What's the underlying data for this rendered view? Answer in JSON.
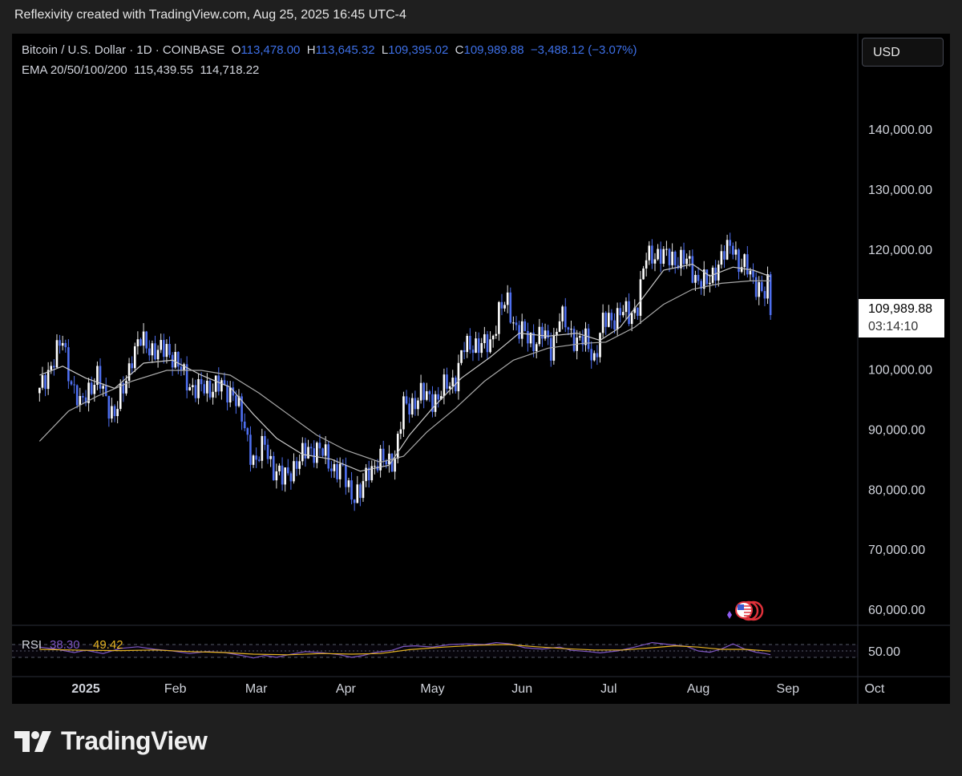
{
  "caption": "Reflexivity created with TradingView.com, Aug 25, 2025 16:45 UTC-4",
  "legend": {
    "symbol": "Bitcoin / U.S. Dollar · 1D · COINBASE",
    "o_label": "O",
    "o_value": "113,478.00",
    "h_label": "H",
    "h_value": "113,645.32",
    "l_label": "L",
    "l_value": "109,395.02",
    "c_label": "C",
    "c_value": "109,989.88",
    "change": "−3,488.12 (−3.07%)",
    "ema_label": "EMA 20/50/100/200",
    "ema_values": [
      "115,439.55",
      "114,718.22"
    ],
    "rsi_label": "RSI",
    "rsi_values": [
      "38.30",
      "49.42"
    ]
  },
  "currency_button": "USD",
  "price_label": {
    "value": "109,989.88",
    "countdown": "03:14:10"
  },
  "brand": "TradingView",
  "colors": {
    "candle": "#4e6ff0",
    "ema": "#c8c8c8",
    "rsi": "#7e57c2",
    "rsi_ma": "#e6b422",
    "background": "#000000"
  },
  "chart_data": {
    "type": "candlestick",
    "y_axis_labels": [
      "140,000.00",
      "130,000.00",
      "120,000.00",
      "100,000.00",
      "90,000.00",
      "80,000.00",
      "70,000.00",
      "60,000.00"
    ],
    "y_axis_values": [
      140000,
      130000,
      120000,
      100000,
      90000,
      80000,
      70000,
      60000
    ],
    "ylim": [
      57500,
      150000
    ],
    "x_axis_labels": [
      "2025",
      "Feb",
      "Mar",
      "Apr",
      "May",
      "Jun",
      "Jul",
      "Aug",
      "Sep",
      "Oct"
    ],
    "x_axis_days": [
      0,
      31,
      59,
      90,
      120,
      151,
      181,
      212,
      243,
      273
    ],
    "close_series": [
      [
        -16,
        96000
      ],
      [
        -12,
        101000
      ],
      [
        -8,
        104500
      ],
      [
        -5,
        98000
      ],
      [
        -2,
        93500
      ],
      [
        1,
        97000
      ],
      [
        4,
        98500
      ],
      [
        7,
        95000
      ],
      [
        10,
        92500
      ],
      [
        13,
        96500
      ],
      [
        16,
        102500
      ],
      [
        19,
        104500
      ],
      [
        22,
        104000
      ],
      [
        25,
        102500
      ],
      [
        28,
        103500
      ],
      [
        30,
        102400
      ],
      [
        33,
        99500
      ],
      [
        36,
        97500
      ],
      [
        39,
        96500
      ],
      [
        42,
        96800
      ],
      [
        45,
        97600
      ],
      [
        48,
        96200
      ],
      [
        51,
        96600
      ],
      [
        54,
        91500
      ],
      [
        57,
        86500
      ],
      [
        59,
        84500
      ],
      [
        62,
        87500
      ],
      [
        65,
        83500
      ],
      [
        68,
        81500
      ],
      [
        71,
        83500
      ],
      [
        74,
        84500
      ],
      [
        77,
        87000
      ],
      [
        80,
        86500
      ],
      [
        83,
        85500
      ],
      [
        86,
        83500
      ],
      [
        89,
        82500
      ],
      [
        92,
        79500
      ],
      [
        95,
        79000
      ],
      [
        98,
        83500
      ],
      [
        101,
        84500
      ],
      [
        104,
        84500
      ],
      [
        107,
        85500
      ],
      [
        110,
        93500
      ],
      [
        113,
        94500
      ],
      [
        116,
        95500
      ],
      [
        119,
        95500
      ],
      [
        122,
        95000
      ],
      [
        125,
        97500
      ],
      [
        128,
        98500
      ],
      [
        131,
        103500
      ],
      [
        134,
        104500
      ],
      [
        137,
        103500
      ],
      [
        140,
        104500
      ],
      [
        143,
        109500
      ],
      [
        146,
        111000
      ],
      [
        149,
        107000
      ],
      [
        152,
        105500
      ],
      [
        155,
        104800
      ],
      [
        158,
        105800
      ],
      [
        161,
        103500
      ],
      [
        164,
        108800
      ],
      [
        167,
        106500
      ],
      [
        170,
        105000
      ],
      [
        173,
        104500
      ],
      [
        176,
        102000
      ],
      [
        179,
        107500
      ],
      [
        182,
        108500
      ],
      [
        185,
        109500
      ],
      [
        188,
        108800
      ],
      [
        191,
        111000
      ],
      [
        194,
        118500
      ],
      [
        197,
        119500
      ],
      [
        200,
        118500
      ],
      [
        203,
        118800
      ],
      [
        206,
        118000
      ],
      [
        209,
        117500
      ],
      [
        212,
        114800
      ],
      [
        215,
        114000
      ],
      [
        218,
        117000
      ],
      [
        221,
        119000
      ],
      [
        224,
        121000
      ],
      [
        226,
        117500
      ],
      [
        229,
        116500
      ],
      [
        232,
        114500
      ],
      [
        235,
        112000
      ],
      [
        236,
        113478
      ],
      [
        237,
        109990
      ]
    ],
    "ema_20": [
      [
        -16,
        99000
      ],
      [
        -8,
        100500
      ],
      [
        0,
        98500
      ],
      [
        10,
        96800
      ],
      [
        20,
        101000
      ],
      [
        30,
        101500
      ],
      [
        40,
        99000
      ],
      [
        50,
        97000
      ],
      [
        58,
        92500
      ],
      [
        66,
        88500
      ],
      [
        75,
        85800
      ],
      [
        85,
        85000
      ],
      [
        95,
        83000
      ],
      [
        105,
        84000
      ],
      [
        112,
        89000
      ],
      [
        120,
        93500
      ],
      [
        130,
        98500
      ],
      [
        140,
        102000
      ],
      [
        150,
        106000
      ],
      [
        160,
        105500
      ],
      [
        170,
        106000
      ],
      [
        178,
        104800
      ],
      [
        185,
        107000
      ],
      [
        193,
        112000
      ],
      [
        200,
        116500
      ],
      [
        210,
        117500
      ],
      [
        216,
        115500
      ],
      [
        224,
        117000
      ],
      [
        231,
        116500
      ],
      [
        237,
        115440
      ]
    ],
    "ema_50": [
      [
        -16,
        88000
      ],
      [
        -6,
        93000
      ],
      [
        4,
        95500
      ],
      [
        16,
        98000
      ],
      [
        28,
        99800
      ],
      [
        40,
        99800
      ],
      [
        50,
        99000
      ],
      [
        60,
        96000
      ],
      [
        70,
        92500
      ],
      [
        80,
        89000
      ],
      [
        90,
        86500
      ],
      [
        102,
        84500
      ],
      [
        110,
        85500
      ],
      [
        118,
        89500
      ],
      [
        128,
        93500
      ],
      [
        138,
        98000
      ],
      [
        148,
        101500
      ],
      [
        160,
        103500
      ],
      [
        172,
        104300
      ],
      [
        180,
        104500
      ],
      [
        190,
        107000
      ],
      [
        200,
        110800
      ],
      [
        210,
        113300
      ],
      [
        220,
        114300
      ],
      [
        230,
        114700
      ],
      [
        237,
        114718
      ]
    ],
    "rsi": [
      [
        -16,
        62
      ],
      [
        -10,
        55
      ],
      [
        -4,
        45
      ],
      [
        0,
        52
      ],
      [
        6,
        42
      ],
      [
        12,
        58
      ],
      [
        18,
        63
      ],
      [
        24,
        55
      ],
      [
        30,
        50
      ],
      [
        36,
        42
      ],
      [
        42,
        48
      ],
      [
        48,
        45
      ],
      [
        54,
        36
      ],
      [
        58,
        28
      ],
      [
        62,
        36
      ],
      [
        66,
        30
      ],
      [
        70,
        38
      ],
      [
        76,
        48
      ],
      [
        82,
        44
      ],
      [
        88,
        38
      ],
      [
        92,
        30
      ],
      [
        96,
        36
      ],
      [
        100,
        45
      ],
      [
        106,
        52
      ],
      [
        110,
        64
      ],
      [
        114,
        66
      ],
      [
        120,
        62
      ],
      [
        126,
        70
      ],
      [
        132,
        72
      ],
      [
        138,
        70
      ],
      [
        142,
        76
      ],
      [
        147,
        72
      ],
      [
        152,
        60
      ],
      [
        158,
        56
      ],
      [
        164,
        62
      ],
      [
        168,
        52
      ],
      [
        174,
        48
      ],
      [
        178,
        44
      ],
      [
        184,
        50
      ],
      [
        190,
        62
      ],
      [
        196,
        76
      ],
      [
        202,
        70
      ],
      [
        208,
        64
      ],
      [
        212,
        50
      ],
      [
        216,
        46
      ],
      [
        220,
        56
      ],
      [
        224,
        72
      ],
      [
        228,
        56
      ],
      [
        232,
        46
      ],
      [
        235,
        42
      ],
      [
        237,
        38.3
      ]
    ],
    "rsi_ma": [
      [
        -16,
        55
      ],
      [
        0,
        52
      ],
      [
        12,
        51
      ],
      [
        24,
        53
      ],
      [
        36,
        48
      ],
      [
        48,
        45
      ],
      [
        58,
        40
      ],
      [
        70,
        38
      ],
      [
        82,
        42
      ],
      [
        92,
        40
      ],
      [
        102,
        42
      ],
      [
        112,
        54
      ],
      [
        124,
        62
      ],
      [
        136,
        68
      ],
      [
        146,
        70
      ],
      [
        156,
        63
      ],
      [
        166,
        57
      ],
      [
        176,
        53
      ],
      [
        186,
        53
      ],
      [
        196,
        60
      ],
      [
        204,
        66
      ],
      [
        212,
        62
      ],
      [
        220,
        55
      ],
      [
        228,
        55
      ],
      [
        237,
        49.42
      ]
    ],
    "rsi_axis_label": "50.00",
    "rsi_bands": [
      70,
      50,
      30
    ]
  }
}
